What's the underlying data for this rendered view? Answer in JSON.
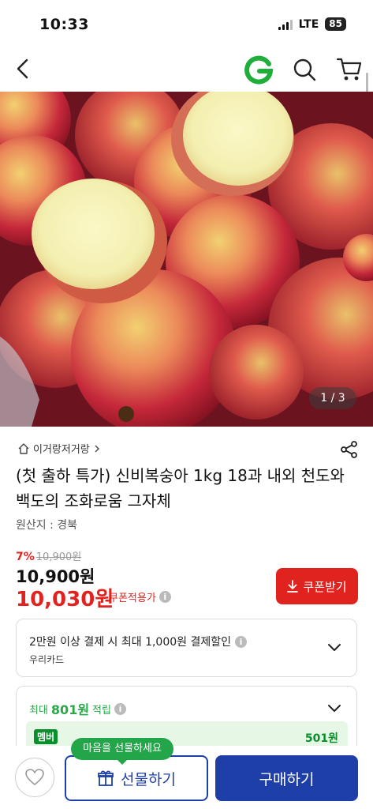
{
  "status_bar": {
    "time": "10:33",
    "network": "LTE",
    "battery": "85"
  },
  "nav": {
    "icons": [
      "back-icon",
      "gmarket-g-logo",
      "search-icon",
      "cart-icon"
    ],
    "logo_color": "#1fae3a"
  },
  "gallery": {
    "counter": "1 / 3"
  },
  "product": {
    "store": "이거랑저거랑",
    "title": "(첫 출하 특가) 신비복숭아 1kg 18과 내외 천도와 백도의 조화로움 그자체",
    "origin": "원산지 : 경북",
    "discount_pct": "7%",
    "original_price": "10,900원",
    "price": "10,900원",
    "coupon_price": "10,030원",
    "coupon_note": "쿠폰적용가",
    "coupon_button": "쿠폰받기"
  },
  "card_benefit": {
    "line1": "2만원 이상 결제 시 최대 1,000원 결제할인",
    "line2": "우리카드"
  },
  "points": {
    "prefix": "최대",
    "amount": "801원",
    "suffix": "적립",
    "member_tag": "멤버",
    "member_amount": "501원"
  },
  "bottom_bar": {
    "gift_tooltip": "마음을 선물하세요",
    "gift_button": "선물하기",
    "buy_button": "구매하기"
  },
  "colors": {
    "accent_red": "#e0231e",
    "brand_blue": "#1e3fa8",
    "green": "#23a64a"
  }
}
